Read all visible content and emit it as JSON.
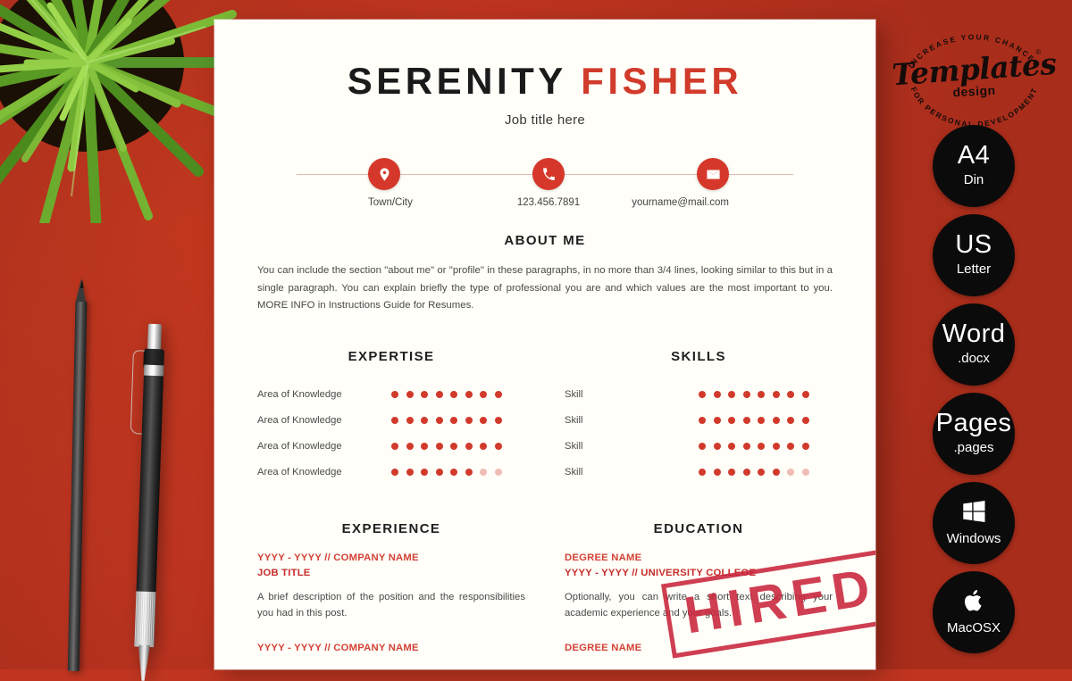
{
  "theme": {
    "background_red": "#BF3520",
    "accent_red": "#D13A2B",
    "dark": "#1A1A1A",
    "page_white": "#FFFEF8",
    "badge_black": "#0B0B0B",
    "stamp_red": "#C9243B"
  },
  "resume": {
    "name_first": "SERENITY",
    "name_last": "FISHER",
    "job_title": "Job title here",
    "contacts": [
      {
        "icon": "location-pin-icon",
        "text": "Town/City"
      },
      {
        "icon": "phone-icon",
        "text": "123.456.7891"
      },
      {
        "icon": "envelope-icon",
        "text": "yourname@mail.com"
      }
    ],
    "about": {
      "heading": "ABOUT ME",
      "body": "You can include the section \"about me\" or \"profile\" in these paragraphs, in no more than 3/4 lines, looking similar to this but in a single paragraph. You can explain briefly the type of professional you are and which values are the most important to you. MORE INFO in Instructions Guide for Resumes."
    },
    "expertise": {
      "heading": "EXPERTISE",
      "total_dots": 8,
      "rows": [
        {
          "label": "Area of Knowledge",
          "filled": 8
        },
        {
          "label": "Area of Knowledge",
          "filled": 8
        },
        {
          "label": "Area of Knowledge",
          "filled": 8
        },
        {
          "label": "Area of Knowledge",
          "filled": 6
        }
      ]
    },
    "skills": {
      "heading": "SKILLS",
      "total_dots": 8,
      "rows": [
        {
          "label": "Skill",
          "filled": 8
        },
        {
          "label": "Skill",
          "filled": 8
        },
        {
          "label": "Skill",
          "filled": 8
        },
        {
          "label": "Skill",
          "filled": 6
        }
      ]
    },
    "experience": {
      "heading": "EXPERIENCE",
      "entries": [
        {
          "meta": "YYYY - YYYY // COMPANY NAME",
          "role": "JOB TITLE",
          "desc": "A brief description of the position and the responsibilities you had in this post."
        },
        {
          "meta": "YYYY - YYYY // COMPANY NAME",
          "role": "",
          "desc": ""
        }
      ]
    },
    "education": {
      "heading": "EDUCATION",
      "entries": [
        {
          "meta": "DEGREE NAME",
          "role": "YYYY - YYYY // UNIVERSITY COLLEGE",
          "desc": "Optionally, you can write a short text describing your academic experience and your goals."
        },
        {
          "meta": "DEGREE NAME",
          "role": "",
          "desc": ""
        }
      ]
    },
    "stamp": "HIRED"
  },
  "sidebar": {
    "logo": {
      "arc_top": "INCREASE YOUR CHANCES",
      "word": "Templates",
      "sub": "design",
      "arc_bottom": "FOR PERSONAL DEVELOPMENT",
      "registered_mark": "®"
    },
    "badges": [
      {
        "icon": "",
        "line1": "A4",
        "line2": "Din"
      },
      {
        "icon": "",
        "line1": "US",
        "line2": "Letter"
      },
      {
        "icon": "",
        "line1": "Word",
        "line2": ".docx"
      },
      {
        "icon": "",
        "line1": "Pages",
        "line2": ".pages"
      },
      {
        "icon": "windows-logo-icon",
        "line1": "",
        "line2": "Windows"
      },
      {
        "icon": "apple-logo-icon",
        "line1": "",
        "line2": "MacOSX"
      }
    ]
  },
  "decor": {
    "plant": "potted-spiky-plant",
    "pencil": "black-pencil",
    "pen": "black-ballpoint-pen"
  }
}
